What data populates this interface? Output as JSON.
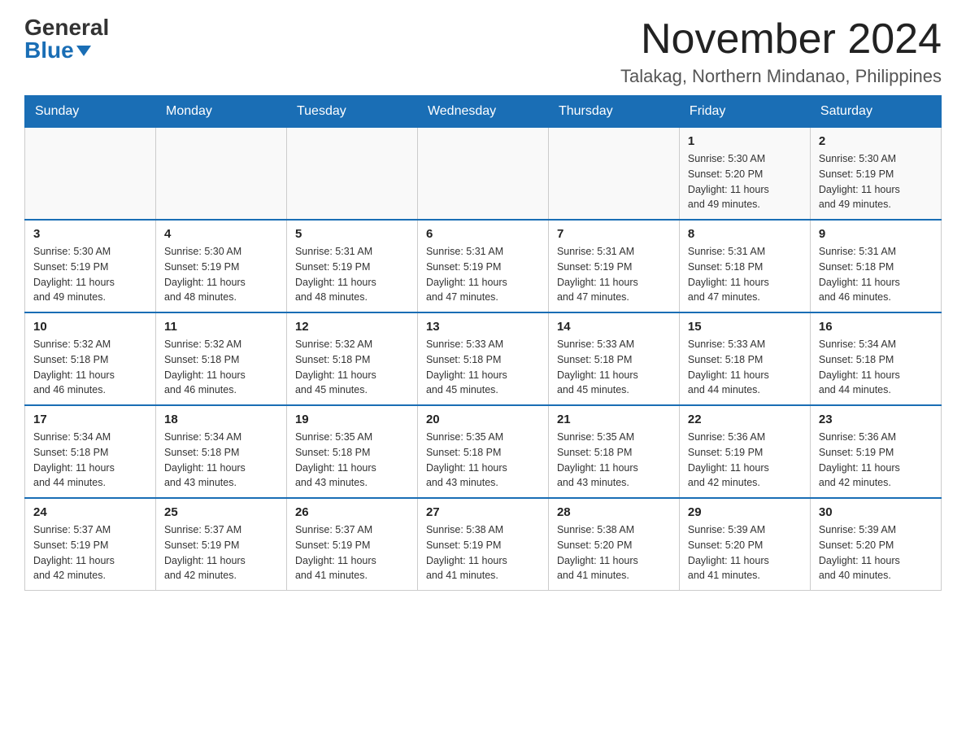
{
  "logo": {
    "general": "General",
    "blue": "Blue"
  },
  "header": {
    "month_title": "November 2024",
    "location": "Talakag, Northern Mindanao, Philippines"
  },
  "days_of_week": [
    "Sunday",
    "Monday",
    "Tuesday",
    "Wednesday",
    "Thursday",
    "Friday",
    "Saturday"
  ],
  "weeks": [
    [
      {
        "day": "",
        "info": ""
      },
      {
        "day": "",
        "info": ""
      },
      {
        "day": "",
        "info": ""
      },
      {
        "day": "",
        "info": ""
      },
      {
        "day": "",
        "info": ""
      },
      {
        "day": "1",
        "info": "Sunrise: 5:30 AM\nSunset: 5:20 PM\nDaylight: 11 hours\nand 49 minutes."
      },
      {
        "day": "2",
        "info": "Sunrise: 5:30 AM\nSunset: 5:19 PM\nDaylight: 11 hours\nand 49 minutes."
      }
    ],
    [
      {
        "day": "3",
        "info": "Sunrise: 5:30 AM\nSunset: 5:19 PM\nDaylight: 11 hours\nand 49 minutes."
      },
      {
        "day": "4",
        "info": "Sunrise: 5:30 AM\nSunset: 5:19 PM\nDaylight: 11 hours\nand 48 minutes."
      },
      {
        "day": "5",
        "info": "Sunrise: 5:31 AM\nSunset: 5:19 PM\nDaylight: 11 hours\nand 48 minutes."
      },
      {
        "day": "6",
        "info": "Sunrise: 5:31 AM\nSunset: 5:19 PM\nDaylight: 11 hours\nand 47 minutes."
      },
      {
        "day": "7",
        "info": "Sunrise: 5:31 AM\nSunset: 5:19 PM\nDaylight: 11 hours\nand 47 minutes."
      },
      {
        "day": "8",
        "info": "Sunrise: 5:31 AM\nSunset: 5:18 PM\nDaylight: 11 hours\nand 47 minutes."
      },
      {
        "day": "9",
        "info": "Sunrise: 5:31 AM\nSunset: 5:18 PM\nDaylight: 11 hours\nand 46 minutes."
      }
    ],
    [
      {
        "day": "10",
        "info": "Sunrise: 5:32 AM\nSunset: 5:18 PM\nDaylight: 11 hours\nand 46 minutes."
      },
      {
        "day": "11",
        "info": "Sunrise: 5:32 AM\nSunset: 5:18 PM\nDaylight: 11 hours\nand 46 minutes."
      },
      {
        "day": "12",
        "info": "Sunrise: 5:32 AM\nSunset: 5:18 PM\nDaylight: 11 hours\nand 45 minutes."
      },
      {
        "day": "13",
        "info": "Sunrise: 5:33 AM\nSunset: 5:18 PM\nDaylight: 11 hours\nand 45 minutes."
      },
      {
        "day": "14",
        "info": "Sunrise: 5:33 AM\nSunset: 5:18 PM\nDaylight: 11 hours\nand 45 minutes."
      },
      {
        "day": "15",
        "info": "Sunrise: 5:33 AM\nSunset: 5:18 PM\nDaylight: 11 hours\nand 44 minutes."
      },
      {
        "day": "16",
        "info": "Sunrise: 5:34 AM\nSunset: 5:18 PM\nDaylight: 11 hours\nand 44 minutes."
      }
    ],
    [
      {
        "day": "17",
        "info": "Sunrise: 5:34 AM\nSunset: 5:18 PM\nDaylight: 11 hours\nand 44 minutes."
      },
      {
        "day": "18",
        "info": "Sunrise: 5:34 AM\nSunset: 5:18 PM\nDaylight: 11 hours\nand 43 minutes."
      },
      {
        "day": "19",
        "info": "Sunrise: 5:35 AM\nSunset: 5:18 PM\nDaylight: 11 hours\nand 43 minutes."
      },
      {
        "day": "20",
        "info": "Sunrise: 5:35 AM\nSunset: 5:18 PM\nDaylight: 11 hours\nand 43 minutes."
      },
      {
        "day": "21",
        "info": "Sunrise: 5:35 AM\nSunset: 5:18 PM\nDaylight: 11 hours\nand 43 minutes."
      },
      {
        "day": "22",
        "info": "Sunrise: 5:36 AM\nSunset: 5:19 PM\nDaylight: 11 hours\nand 42 minutes."
      },
      {
        "day": "23",
        "info": "Sunrise: 5:36 AM\nSunset: 5:19 PM\nDaylight: 11 hours\nand 42 minutes."
      }
    ],
    [
      {
        "day": "24",
        "info": "Sunrise: 5:37 AM\nSunset: 5:19 PM\nDaylight: 11 hours\nand 42 minutes."
      },
      {
        "day": "25",
        "info": "Sunrise: 5:37 AM\nSunset: 5:19 PM\nDaylight: 11 hours\nand 42 minutes."
      },
      {
        "day": "26",
        "info": "Sunrise: 5:37 AM\nSunset: 5:19 PM\nDaylight: 11 hours\nand 41 minutes."
      },
      {
        "day": "27",
        "info": "Sunrise: 5:38 AM\nSunset: 5:19 PM\nDaylight: 11 hours\nand 41 minutes."
      },
      {
        "day": "28",
        "info": "Sunrise: 5:38 AM\nSunset: 5:20 PM\nDaylight: 11 hours\nand 41 minutes."
      },
      {
        "day": "29",
        "info": "Sunrise: 5:39 AM\nSunset: 5:20 PM\nDaylight: 11 hours\nand 41 minutes."
      },
      {
        "day": "30",
        "info": "Sunrise: 5:39 AM\nSunset: 5:20 PM\nDaylight: 11 hours\nand 40 minutes."
      }
    ]
  ]
}
